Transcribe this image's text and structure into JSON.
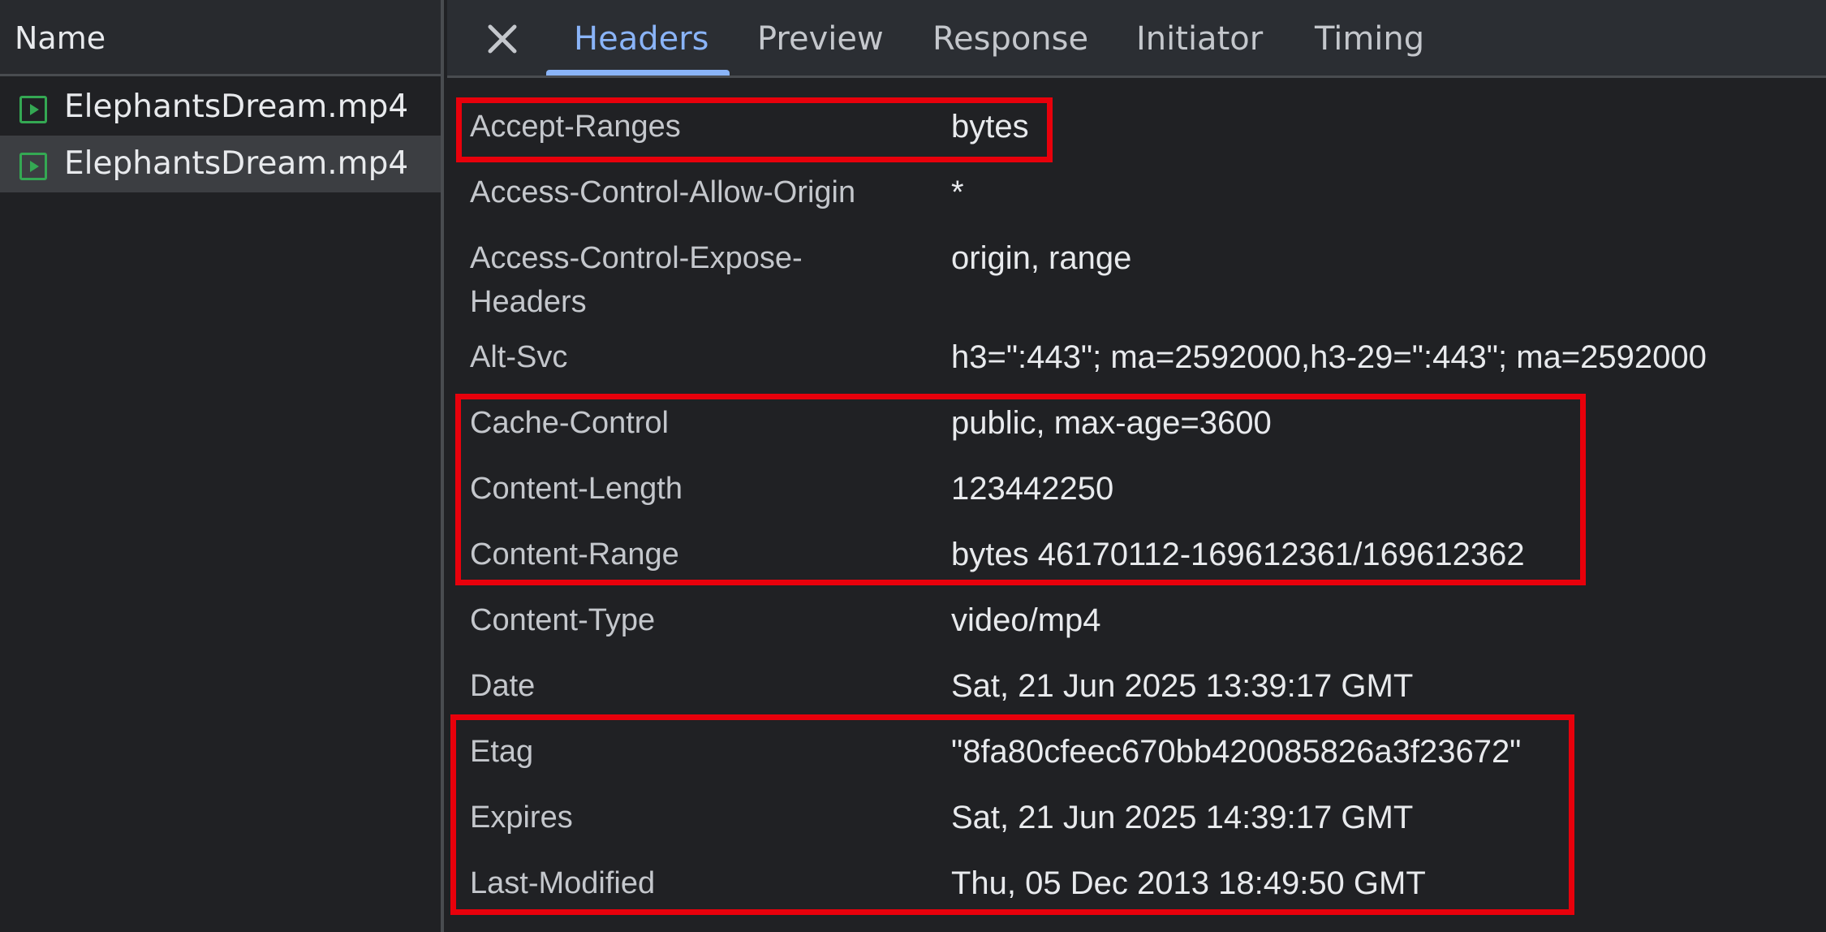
{
  "sidebar": {
    "header": "Name",
    "files": [
      {
        "name": "ElephantsDream.mp4",
        "icon": "media-file-icon"
      },
      {
        "name": "ElephantsDream.mp4",
        "icon": "media-file-icon",
        "selected": true
      }
    ]
  },
  "tabs": {
    "close_icon": "close-icon",
    "items": [
      {
        "label": "Headers",
        "active": true
      },
      {
        "label": "Preview"
      },
      {
        "label": "Response"
      },
      {
        "label": "Initiator"
      },
      {
        "label": "Timing"
      }
    ]
  },
  "headers": [
    {
      "name": "Accept-Ranges",
      "value": "bytes"
    },
    {
      "name": "Access-Control-Allow-Origin",
      "value": "*"
    },
    {
      "name": "Access-Control-Expose-Headers",
      "name_line1": "Access-Control-Expose-",
      "name_line2": "Headers",
      "value": "origin, range"
    },
    {
      "name": "Alt-Svc",
      "value": "h3=\":443\"; ma=2592000,h3-29=\":443\"; ma=2592000"
    },
    {
      "name": "Cache-Control",
      "value": "public, max-age=3600"
    },
    {
      "name": "Content-Length",
      "value": "123442250"
    },
    {
      "name": "Content-Range",
      "value": "bytes 46170112-169612361/169612362"
    },
    {
      "name": "Content-Type",
      "value": "video/mp4"
    },
    {
      "name": "Date",
      "value": "Sat, 21 Jun 2025 13:39:17 GMT"
    },
    {
      "name": "Etag",
      "value": "\"8fa80cfeec670bb420085826a3f23672\""
    },
    {
      "name": "Expires",
      "value": "Sat, 21 Jun 2025 14:39:17 GMT"
    },
    {
      "name": "Last-Modified",
      "value": "Thu, 05 Dec 2013 18:49:50 GMT"
    }
  ],
  "colors": {
    "highlight": "#e8000b",
    "active_tab": "#8ab4f8",
    "file_icon": "#34a853",
    "background": "#202124"
  }
}
